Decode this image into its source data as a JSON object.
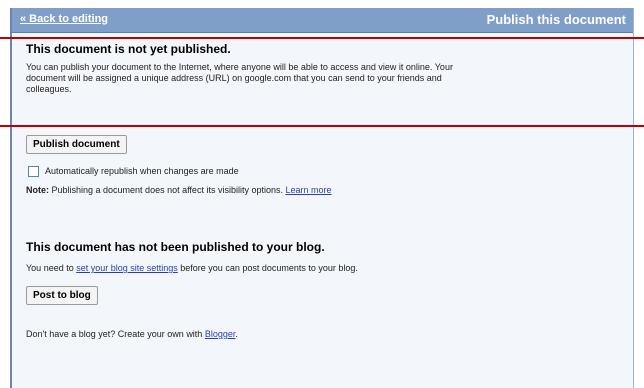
{
  "header": {
    "back_link": "« Back to editing",
    "title": "Publish this document"
  },
  "publish": {
    "heading": "This document is not yet published.",
    "description_line1": "You can publish your document to the Internet, where anyone will be able to access and view it online. Your",
    "description_line2": "document will be assigned a unique address (URL) on google.com that you can send to your friends and",
    "description_line3": "colleagues.",
    "button_label": "Publish document",
    "auto_republish_label": "Automatically republish when changes are made",
    "auto_republish_checked": false,
    "note_label": "Note:",
    "note_text": " Publishing a document does not affect its visibility options. ",
    "learn_more": "Learn more"
  },
  "blog": {
    "heading": "This document has not been published to your blog.",
    "text_before": "You need to ",
    "settings_link": "set your blog site settings",
    "text_after": " before you can post documents to your blog.",
    "button_label": "Post to blog",
    "footer_before": "Don't have a blog yet? Create your own with ",
    "blogger_link": "Blogger",
    "footer_after": "."
  },
  "colors": {
    "header_bg": "#7f9fc9",
    "annotation_line": "#c00000",
    "link": "#2a3fb0"
  }
}
